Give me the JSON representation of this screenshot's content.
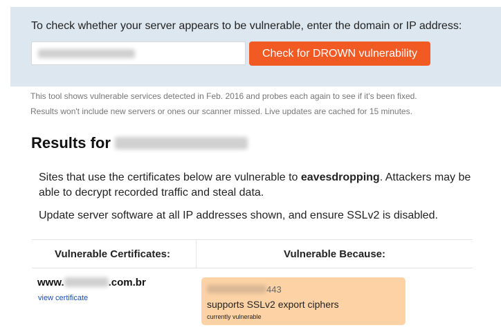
{
  "check_form": {
    "prompt": "To check whether your server appears to be vulnerable, enter the domain or IP address:",
    "input_value": "",
    "button_label": "Check for DROWN vulnerability"
  },
  "note": {
    "line1": "This tool shows vulnerable services detected in Feb. 2016 and probes each again to see if it's been fixed.",
    "line2": "Results won't include new servers or ones our scanner missed. Live updates are cached for 15 minutes."
  },
  "results": {
    "heading_prefix": "Results for",
    "warning_before": "Sites that use the certificates below are vulnerable to ",
    "warning_bold": "eavesdropping",
    "warning_after": ". Attackers may be able to decrypt recorded traffic and steal data.",
    "update_text": "Update server software at all IP addresses shown, and ensure SSLv2 is disabled."
  },
  "table": {
    "headers": {
      "certificates": "Vulnerable Certificates:",
      "because": "Vulnerable Because:"
    },
    "rows": [
      {
        "host_prefix": "www.",
        "host_suffix": ".com.br",
        "view_link": "view certificate",
        "port": "443",
        "reason": "supports SSLv2 export ciphers",
        "status": "currently vulnerable"
      }
    ]
  },
  "colors": {
    "panel_bg": "#dce7ef",
    "button_bg": "#f25a23",
    "vuln_box_bg": "#fdd3a6",
    "link": "#1a4fb0"
  }
}
